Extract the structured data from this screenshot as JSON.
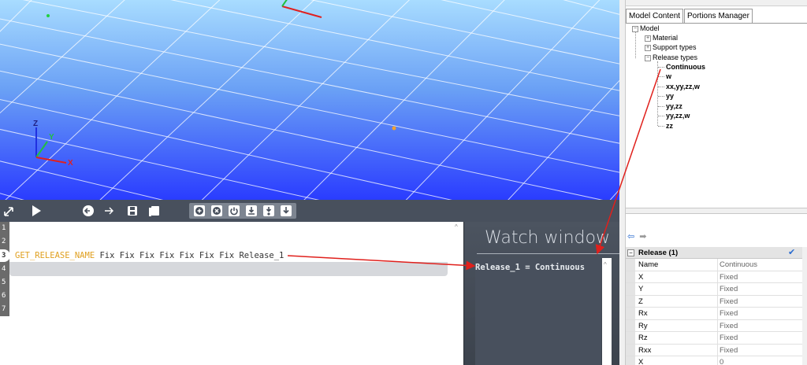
{
  "viewport": {
    "axis_labels": {
      "z": "Z",
      "y": "Y",
      "x": "X"
    }
  },
  "toolbar": {
    "icons": [
      "expand-icon",
      "play-icon",
      "back-circle-icon",
      "forward-arrow-icon",
      "save-icon",
      "copy-icon",
      "add-icon",
      "remove-icon",
      "power-icon",
      "download-icon",
      "step-into-icon",
      "step-down-icon"
    ]
  },
  "editor": {
    "line_numbers": [
      "1",
      "2",
      "3",
      "4",
      "5",
      "6",
      "7"
    ],
    "active_line": "3",
    "code_keyword": "GET_RELEASE_NAME",
    "code_args": " Fix Fix Fix Fix Fix Fix Fix Release_1"
  },
  "watch": {
    "title": "Watch window",
    "value": "Release_1 = Continuous"
  },
  "right_panel": {
    "tabs": [
      "Model Content",
      "Portions Manager"
    ],
    "tree": {
      "root": "Model",
      "items": [
        {
          "label": "Material",
          "expander": "+"
        },
        {
          "label": "Support types",
          "expander": "+"
        },
        {
          "label": "Release types",
          "expander": "−"
        }
      ],
      "release_children": [
        "Continuous",
        "w",
        "xx,yy,zz,w",
        "yy",
        "yy,zz",
        "yy,zz,w",
        "zz"
      ],
      "root_expander": "−"
    },
    "nav": {
      "back": "⇦",
      "forward": "➡"
    },
    "grid": {
      "title": "Release (1)",
      "collapse": "−",
      "header_row": {
        "name": "Name",
        "value": "Continuous"
      },
      "rows": [
        {
          "name": "X",
          "value": "Fixed"
        },
        {
          "name": "Y",
          "value": "Fixed"
        },
        {
          "name": "Z",
          "value": "Fixed"
        },
        {
          "name": "Rx",
          "value": "Fixed"
        },
        {
          "name": "Ry",
          "value": "Fixed"
        },
        {
          "name": "Rz",
          "value": "Fixed"
        },
        {
          "name": "Rxx",
          "value": "Fixed"
        },
        {
          "name": "X",
          "value": "0"
        }
      ]
    }
  },
  "colors": {
    "keyword": "#e0a020",
    "annotation_arrow": "#e0201c",
    "viewport_top": "#a8dcff",
    "viewport_bottom": "#2a3cff"
  }
}
